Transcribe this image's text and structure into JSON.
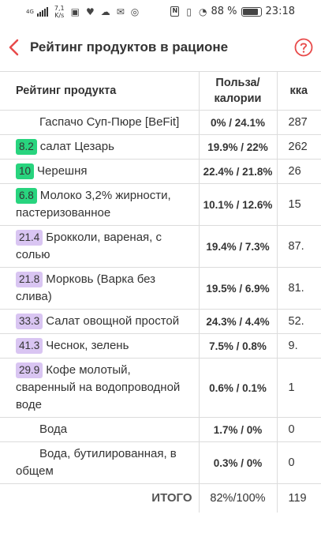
{
  "statusbar": {
    "network": "4G",
    "speed_value": "7,1",
    "speed_unit": "K/s",
    "battery": "88 %",
    "time": "23:18"
  },
  "header": {
    "title": "Рейтинг продуктов в рационе",
    "back_icon": "chevron-left-icon",
    "help_icon": "question-circle-icon",
    "accent_color": "#e84a4a"
  },
  "table": {
    "columns": {
      "name": "Рейтинг продукта",
      "ratio": "Польза/ калории",
      "kcal": "кка"
    },
    "rows": [
      {
        "badge": "",
        "badge_color": "",
        "name": "Гаспачо Суп-Пюре [BeFit]",
        "ratio": "0% / 24.1%",
        "kcal": "287"
      },
      {
        "badge": "8.2",
        "badge_color": "green",
        "name": "салат Цезарь",
        "ratio": "19.9% / 22%",
        "kcal": "262"
      },
      {
        "badge": "10",
        "badge_color": "green",
        "name": "Черешня",
        "ratio": "22.4% / 21.8%",
        "kcal": "26"
      },
      {
        "badge": "6.8",
        "badge_color": "green",
        "name": "Молоко 3,2% жирности, пастеризованное",
        "ratio": "10.1% / 12.6%",
        "kcal": "15"
      },
      {
        "badge": "21.4",
        "badge_color": "purple",
        "name": "Брокколи, вареная, с солью",
        "ratio": "19.4% / 7.3%",
        "kcal": "87."
      },
      {
        "badge": "21.8",
        "badge_color": "purple",
        "name": "Морковь (Варка без слива)",
        "ratio": "19.5% / 6.9%",
        "kcal": "81."
      },
      {
        "badge": "33.3",
        "badge_color": "purple",
        "name": "Салат овощной простой",
        "ratio": "24.3% / 4.4%",
        "kcal": "52."
      },
      {
        "badge": "41.3",
        "badge_color": "purple",
        "name": "Чеснок, зелень",
        "ratio": "7.5% / 0.8%",
        "kcal": "9."
      },
      {
        "badge": "29.9",
        "badge_color": "purple",
        "name": "Кофе молотый, сваренный на водопроводной воде",
        "ratio": "0.6% / 0.1%",
        "kcal": "1"
      },
      {
        "badge": "",
        "badge_color": "",
        "name": "Вода",
        "ratio": "1.7% / 0%",
        "kcal": "0"
      },
      {
        "badge": "",
        "badge_color": "",
        "name": "Вода, бутилированная, в общем",
        "ratio": "0.3% / 0%",
        "kcal": "0"
      }
    ],
    "total": {
      "label": "ИТОГО",
      "ratio": "82%/100%",
      "kcal": "119"
    }
  }
}
